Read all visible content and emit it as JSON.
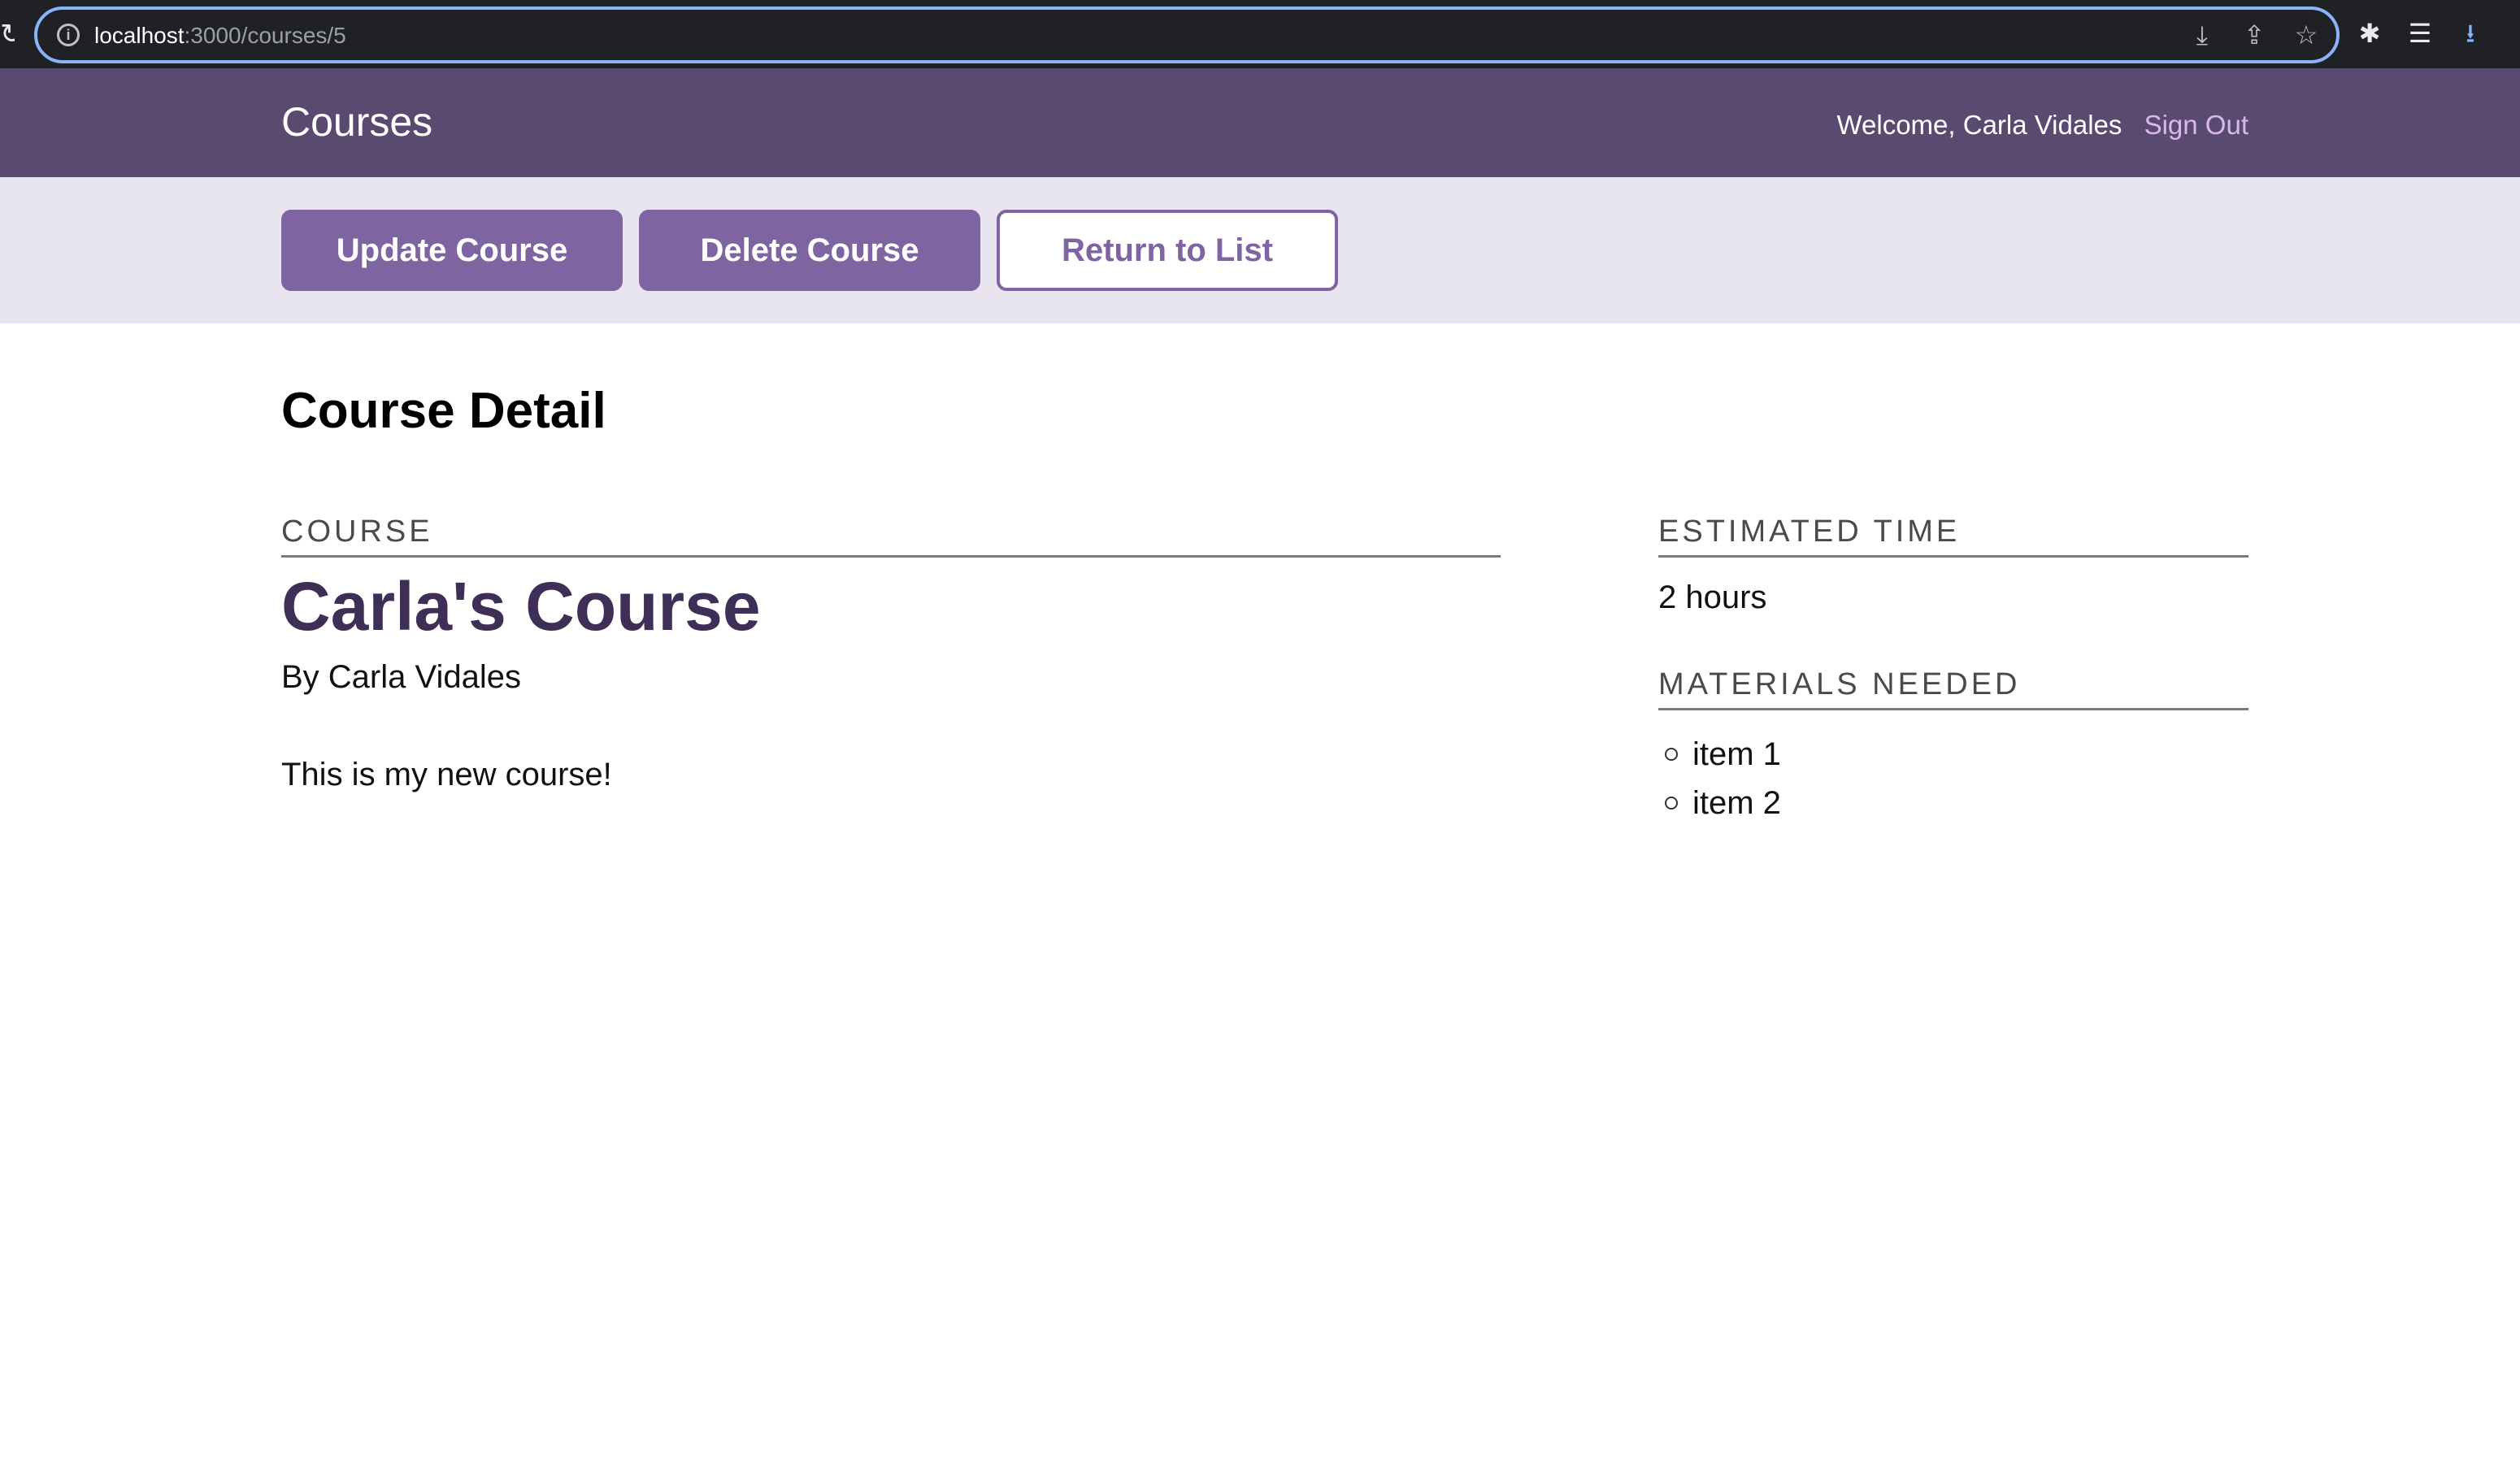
{
  "browser": {
    "url_host": "localhost",
    "url_path": ":3000/courses/5"
  },
  "header": {
    "brand": "Courses",
    "welcome": "Welcome, Carla Vidales",
    "sign_out": "Sign Out"
  },
  "actions": {
    "update": "Update Course",
    "delete": "Delete Course",
    "return": "Return to List"
  },
  "page": {
    "title": "Course Detail"
  },
  "course": {
    "section_label": "Course",
    "title": "Carla's Course",
    "author": "By Carla Vidales",
    "description": "This is my new course!"
  },
  "sidebar": {
    "estimated_time_label": "Estimated Time",
    "estimated_time": "2 hours",
    "materials_label": "Materials Needed",
    "materials": [
      "item 1",
      "item 2"
    ]
  },
  "colors": {
    "header_bg": "#5b4a70",
    "action_bar_bg": "#e8e4f0",
    "button": "#7e64a0",
    "course_title": "#3d2f56",
    "sign_out": "#d9b8f0"
  },
  "icons": {
    "reload": "reload-icon",
    "info": "info-icon",
    "install": "install-icon",
    "share": "share-icon",
    "bookmark": "star-icon",
    "extensions": "puzzle-icon",
    "media": "media-icon",
    "download": "download-icon"
  }
}
